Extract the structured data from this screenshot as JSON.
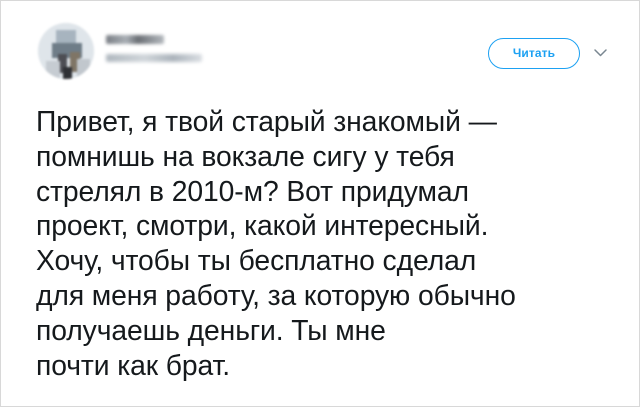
{
  "tweet": {
    "follow_button_label": "Читать",
    "text": "Привет, я твой старый знакомый —\nпомнишь на вокзале сигу у тебя\nстрелял в 2010-м? Вот придумал\nпроект, смотри, какой интересный.\nХочу, чтобы ты бесплатно сделал\nдля меня работу, за которую обычно\nполучаешь деньги. Ты мне\nпочти как брат.",
    "icons": {
      "avatar": "avatar-image",
      "caret": "chevron-down-icon"
    },
    "colors": {
      "accent": "#1da1f2",
      "text": "#15191c",
      "border": "#d8d8d8",
      "background": "#ffffff"
    }
  }
}
